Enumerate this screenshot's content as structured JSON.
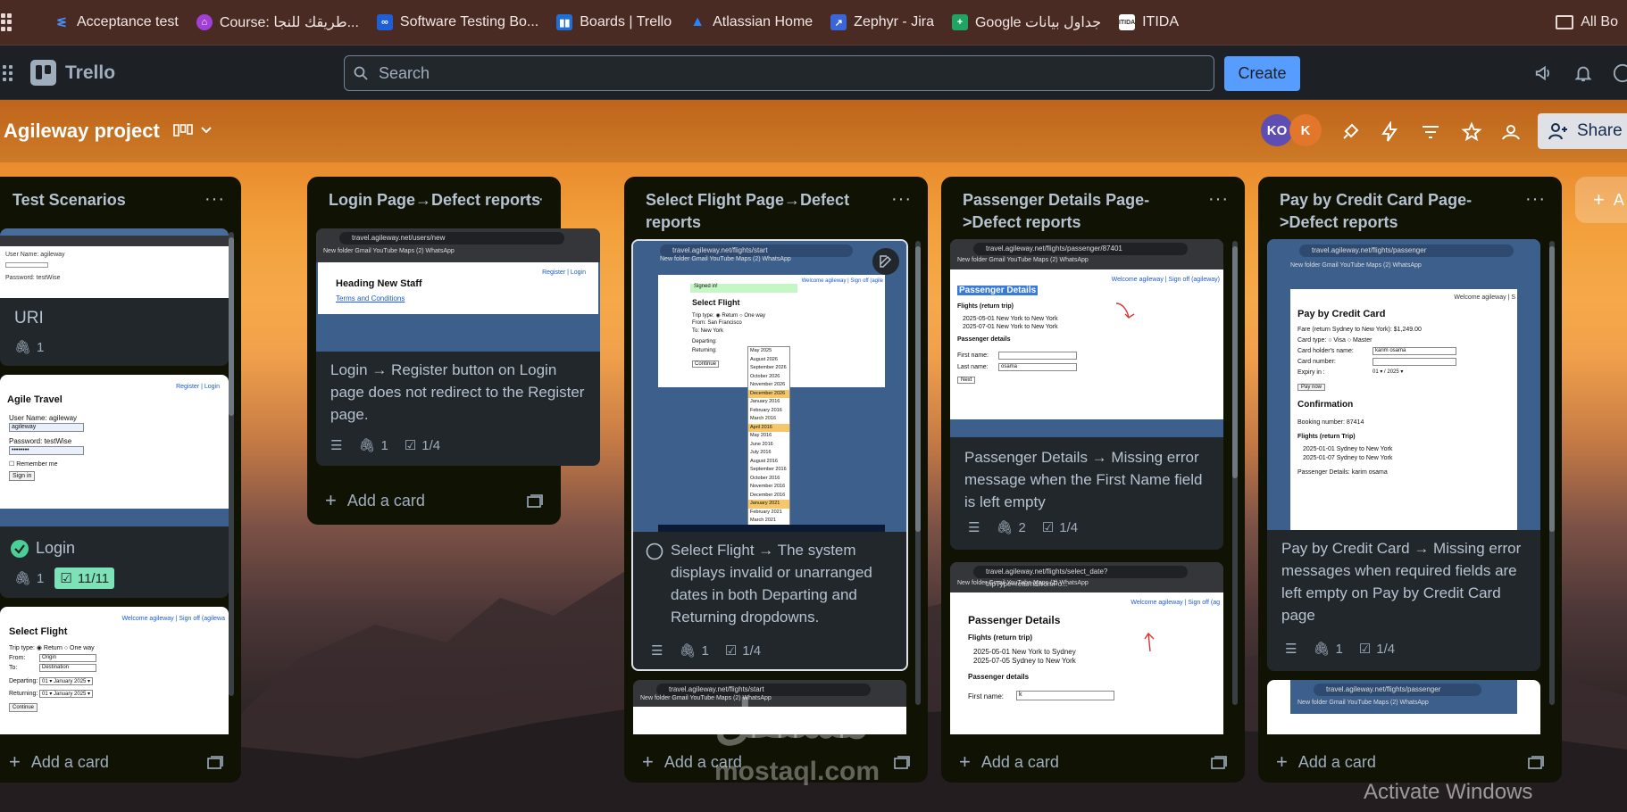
{
  "bookmarks": [
    {
      "label": "Acceptance test",
      "icon": "acceptance-test-icon",
      "color": "#2d6bd9"
    },
    {
      "label": "Course: طريقك للنجا...",
      "icon": "course-icon",
      "color": "#a23fd6"
    },
    {
      "label": "Software Testing Bo...",
      "icon": "software-testing-icon",
      "color": "#1f5fd6"
    },
    {
      "label": "Boards | Trello",
      "icon": "trello-icon",
      "color": "#1f6fd9"
    },
    {
      "label": "Atlassian Home",
      "icon": "atlassian-icon",
      "color": "#2684ff"
    },
    {
      "label": "Zephyr - Jira",
      "icon": "zephyr-icon",
      "color": "#3b66d9"
    },
    {
      "label": "Google جداول بيانات",
      "icon": "google-sheets-icon",
      "color": "#1fa463"
    },
    {
      "label": "ITIDA",
      "icon": "itida-icon",
      "color": "#ffffff"
    }
  ],
  "bookmarks_right": "All Bo",
  "header": {
    "logo_text": "Trello",
    "search_placeholder": "Search",
    "create_label": "Create"
  },
  "board": {
    "title": "Agileway project",
    "avatars": [
      {
        "initials": "KO",
        "color": "#5e4db2"
      },
      {
        "initials": "K",
        "color": "#e2762a"
      }
    ],
    "share_label": "Share",
    "add_list_label": "A"
  },
  "lists": [
    {
      "title": "Test Scenarios",
      "add_card": "Add a card",
      "cards": [
        {
          "title": "URI",
          "attachments": "1"
        },
        {
          "title": "Login",
          "attachments": "1",
          "checklist": "11/11",
          "shot": {
            "heading": "Agile Travel",
            "links": "Register | Login",
            "l1": "User Name: agileway",
            "v1": "agileway",
            "l2": "Password: testWise",
            "v2": "••••••••",
            "remember": "Remember me",
            "btn": "Sign in"
          }
        },
        {
          "title": "",
          "shot": {
            "welcome": "Welcome agileway | Sign off (agilewa",
            "heading": "Select Flight",
            "trip": "Trip type:  ◉ Return  ○ One way",
            "from": "From:",
            "from_v": "Origin",
            "to": "To:",
            "to_v": "Destination",
            "dep": "Departing:",
            "dep_v": "01 ▾  January 2025 ▾",
            "ret": "Returning:",
            "ret_v": "01 ▾  January 2025 ▾",
            "btn": "Continue"
          }
        }
      ]
    },
    {
      "title": "Login Page→Defect reports",
      "add_card": "Add a card",
      "cards": [
        {
          "title": "Login → Register button on Login page does not redirect to the Register page.",
          "attachments": "1",
          "checklist": "1/4",
          "shot": {
            "url": "travel.agileway.net/users/new",
            "bms": "New folder   Gmail   YouTube   Maps   (2) WhatsApp",
            "heading": "Heading New Staff",
            "link": "Terms and Conditions",
            "links": "Register | Login"
          }
        }
      ]
    },
    {
      "title": "Select Flight Page→Defect reports",
      "add_card": "Add a card",
      "cards": [
        {
          "title": "Select Flight → The system displays invalid or unarranged dates in both Departing and Returning dropdowns.",
          "attachments": "1",
          "checklist": "1/4",
          "shot": {
            "url": "travel.agileway.net/flights/start",
            "bms": "New folder   Gmail   YouTube   Maps   (2) WhatsApp",
            "signed": "Signed in!",
            "welcome": "Welcome agileway | Sign off (agile",
            "heading": "Select Flight",
            "trip": "Trip type:  ◉ Return  ○ One way",
            "from": "From:  San Francisco",
            "to": "To:  New York",
            "dep": "Departing:",
            "ret": "Returning:",
            "btn": "Continue",
            "dates": [
              "May 2025",
              "August 2026",
              "September 2026",
              "October 2026",
              "November 2026",
              "December 2026",
              "January 2016",
              "February 2016",
              "March 2016",
              "April 2016",
              "May 2016",
              "June 2016",
              "July 2016",
              "August 2016",
              "September 2016",
              "October 2016",
              "November 2016",
              "December 2016",
              "January 2021",
              "February 2021",
              "March 2021"
            ]
          }
        },
        {
          "title": "",
          "shot": {
            "url": "travel.agileway.net/flights/start",
            "bms": "New folder   Gmail   YouTube   Maps   (2) WhatsApp"
          }
        }
      ]
    },
    {
      "title": "Passenger Details Page->Defect reports",
      "add_card": "Add a card",
      "cards": [
        {
          "title": "Passenger Details → Missing error message when the First Name field is left empty",
          "attachments": "2",
          "checklist": "1/4",
          "shot": {
            "url": "travel.agileway.net/flights/passenger/87401",
            "bms": "New folder   Gmail   YouTube   Maps   (2) WhatsApp",
            "welcome": "Welcome agileway | Sign off (agileway)",
            "heading": "Passenger Details",
            "flights": "Flights (return trip)",
            "f1": "2025-05-01 New York to New York",
            "f2": "2025-07-01 New York to New York",
            "pd": "Passenger details",
            "fn": "First name:",
            "ln": "Last name:",
            "ln_v": "osama",
            "btn": "Next"
          }
        },
        {
          "title": "",
          "shot": {
            "url": "travel.agileway.net/flights/select_date?tripType=return&fromPo...",
            "bms": "New folder   Gmail   YouTube   Maps   (2) WhatsApp",
            "welcome": "Welcome agileway | Sign off (ag",
            "heading": "Passenger Details",
            "flights": "Flights (return trip)",
            "f1": "2025-05-01 New York to Sydney",
            "f2": "2025-07-05 Sydney to New York",
            "pd": "Passenger details",
            "fn": "First name:",
            "fn_v": "k"
          }
        }
      ]
    },
    {
      "title": "Pay by Credit Card Page->Defect reports",
      "add_card": "Add a card",
      "cards": [
        {
          "title": "Pay by Credit Card → Missing error messages when required fields are left empty on Pay by Credit Card page",
          "attachments": "1",
          "checklist": "1/4",
          "shot": {
            "url": "travel.agileway.net/flights/passenger",
            "bms": "New folder   Gmail   YouTube   Maps   (2) WhatsApp",
            "welcome": "Welcome agileway | S",
            "heading": "Pay by Credit Card",
            "fare": "Fare (return Sydney to New York): $1,249.00",
            "ctype": "Card type:      ○ Visa    ○ Master",
            "holder": "Card holder's name:",
            "holder_v": "karim osama",
            "cnum": "Card number:",
            "exp": "Expiry in :",
            "exp_v": "01 ▾  /  2025 ▾",
            "btn": "Pay now",
            "conf": "Confirmation",
            "booking": "Booking number: 87414",
            "flights": "Flights (return Trip)",
            "f1": "2025-01-01 Sydney to New York",
            "f2": "2025-01-07 Sydney to New York",
            "pd": "Passenger Details: karim osama"
          }
        },
        {
          "title": "",
          "shot": {
            "url": "travel.agileway.net/flights/passenger",
            "bms": "New folder   Gmail   YouTube   Maps   (2) WhatsApp"
          }
        }
      ]
    }
  ],
  "watermark": {
    "arabic": "مستقل",
    "latin": "mostaql.com"
  },
  "activate_windows": "Activate Windows"
}
